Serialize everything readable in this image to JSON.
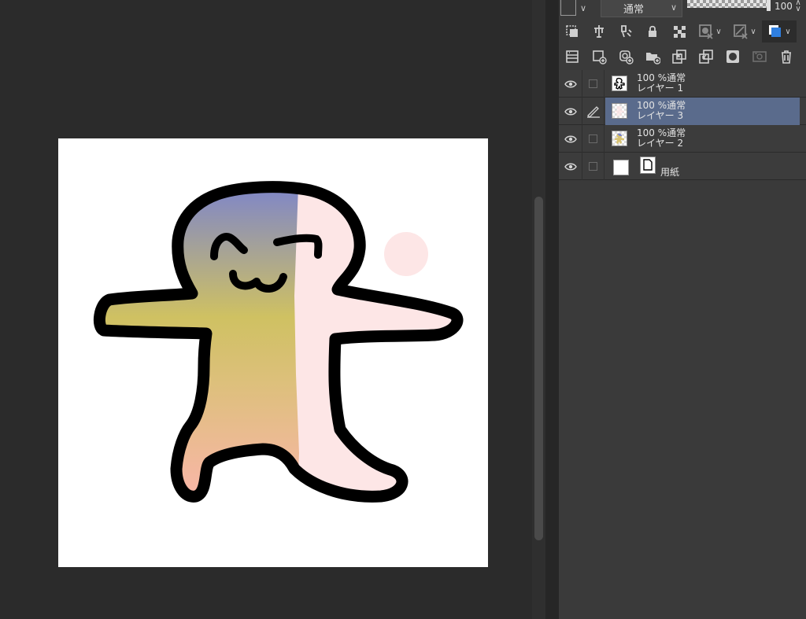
{
  "layer_panel": {
    "blend_mode": "通常",
    "opacity_value": "100",
    "layers": [
      {
        "opacity": "100 %",
        "mode": "通常",
        "name": "レイヤー 1",
        "selected": false,
        "editing": false
      },
      {
        "opacity": "100 %",
        "mode": "通常",
        "name": "レイヤー 3",
        "selected": true,
        "editing": true
      },
      {
        "opacity": "100 %",
        "mode": "通常",
        "name": "レイヤー 2",
        "selected": false,
        "editing": false
      }
    ],
    "paper_layer": {
      "name": "用紙"
    }
  },
  "colors": {
    "workspace_bg": "#2b2b2b",
    "panel_bg": "#3a3a3a",
    "selected_layer": "#5a6b8c",
    "canvas_bg": "#ffffff",
    "outline": "#000000",
    "gradient_top": "#7f86c8",
    "gradient_middle": "#cfc162",
    "gradient_bottom": "#f9b6a8",
    "pale_pink": "#fde6e6"
  },
  "toolbar_icons": {
    "row1": [
      "clip-to-lower-layer-icon",
      "reference-layer-icon",
      "draft-layer-icon",
      "lock-layer-icon",
      "lock-transparent-pixels-icon",
      "mask-enable-icon",
      "ruler-visibility-icon",
      "layer-color-icon"
    ],
    "row2": [
      "layer-properties-icon",
      "new-raster-layer-icon",
      "new-vector-layer-icon",
      "new-folder-icon",
      "transfer-to-lower-layer-icon",
      "combine-with-layer-below-icon",
      "apply-mask-icon",
      "create-layer-mask-icon",
      "delete-layer-icon"
    ]
  }
}
